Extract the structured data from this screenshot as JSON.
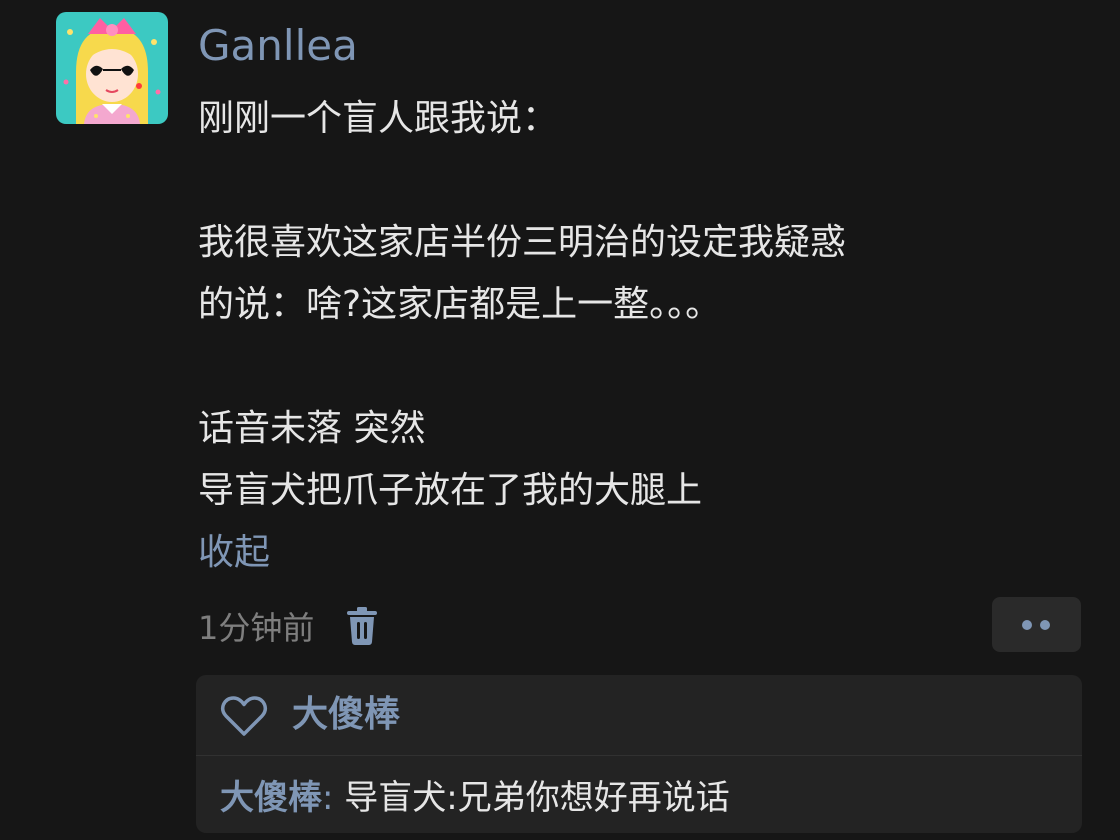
{
  "post": {
    "author": "Ganllea",
    "avatar_icon": "anime-girl-avatar-icon",
    "lines": [
      "刚刚一个盲人跟我说：",
      "",
      "我很喜欢这家店半份三明治的设定我疑惑",
      "的说：啥?这家店都是上一整。。。",
      "",
      "话音未落 突然",
      "导盲犬把爪子放在了我的大腿上"
    ],
    "collapse_label": "收起",
    "timestamp": "1分钟前",
    "delete_icon": "trash-icon",
    "more_icon": "more-dots-icon"
  },
  "comments": {
    "like_icon": "heart-icon",
    "liked_by": "大傻棒",
    "reply": {
      "author": "大傻棒",
      "separator": ":",
      "text": " 导盲犬:兄弟你想好再说话"
    }
  },
  "colors": {
    "background": "#161616",
    "link": "#7f96b5",
    "text": "#e6e6e6",
    "muted": "#7e7e7e",
    "panel": "#232323"
  }
}
